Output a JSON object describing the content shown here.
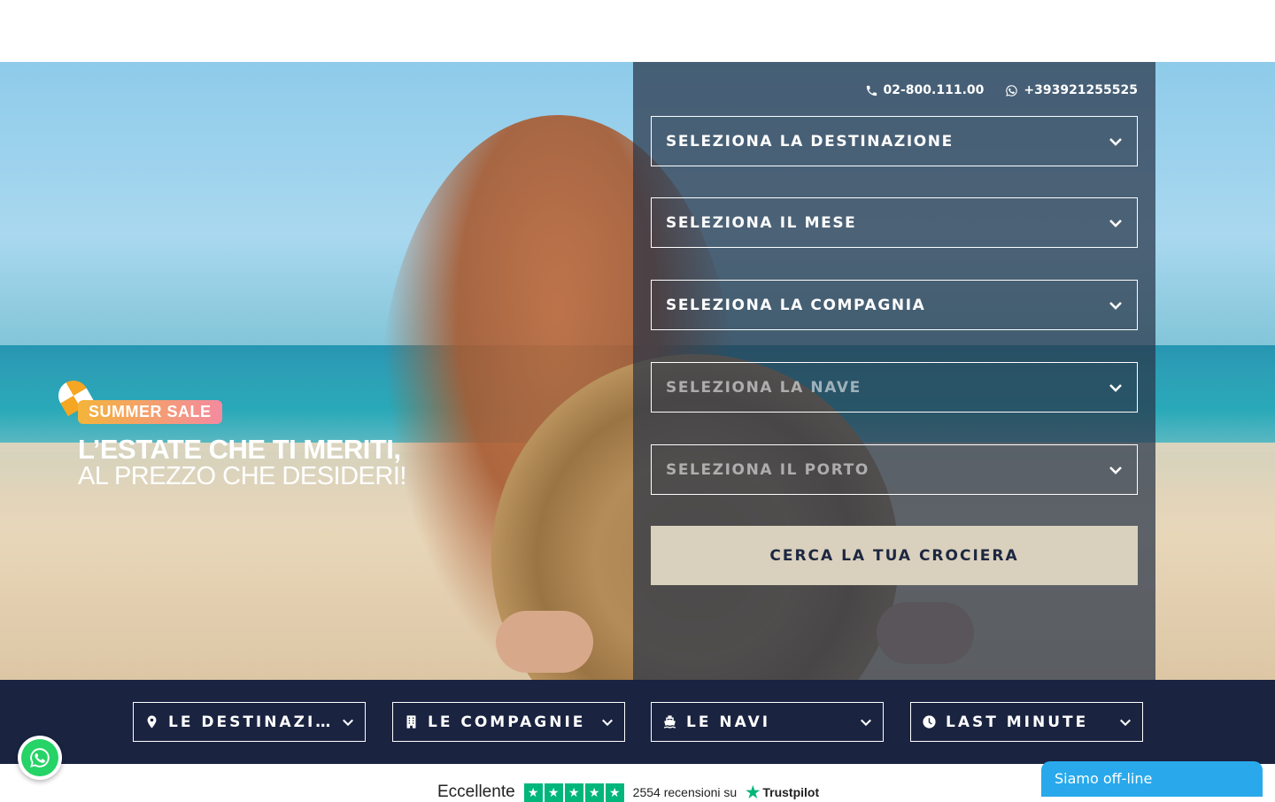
{
  "hero": {
    "promo": {
      "badge": "SUMMER SALE",
      "line1": "L’ESTATE CHE TI MERITI,",
      "line2": "AL PREZZO CHE DESIDERI!"
    }
  },
  "contacts": {
    "phone": "02-800.111.00",
    "whatsapp": "+393921255525"
  },
  "search": {
    "destination": "SELEZIONA LA DESTINAZIONE",
    "month": "SELEZIONA IL MESE",
    "company": "SELEZIONA LA COMPAGNIA",
    "ship": "SELEZIONA LA NAVE",
    "port": "SELEZIONA IL PORTO",
    "submit": "CERCA LA TUA CROCIERA"
  },
  "nav": {
    "items": [
      {
        "label": "LE DESTINAZIONI",
        "icon": "map-pin-icon"
      },
      {
        "label": "LE COMPAGNIE",
        "icon": "building-icon"
      },
      {
        "label": "LE NAVI",
        "icon": "ship-icon"
      },
      {
        "label": "LAST MINUTE",
        "icon": "clock-icon"
      }
    ]
  },
  "trustpilot": {
    "rating_word": "Eccellente",
    "reviews": "2554 recensioni su",
    "brand": "Trustpilot",
    "stars": 5
  },
  "chat": {
    "status": "Siamo off-line"
  },
  "colors": {
    "navy": "#1a2340",
    "button_beige": "#d9d0bd",
    "chat_blue": "#29a9eb",
    "whatsapp_green": "#25d366",
    "trustpilot_green": "#00b67a"
  }
}
